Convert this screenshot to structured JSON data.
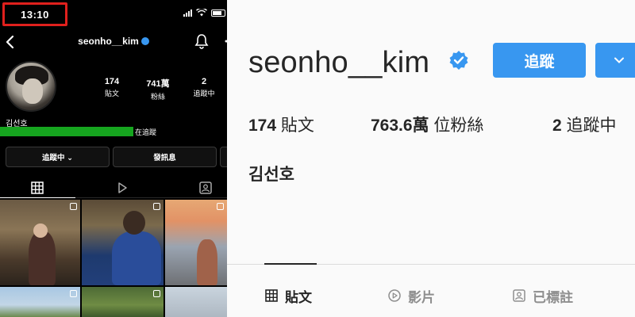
{
  "phone": {
    "time": "13:10",
    "username": "seonho__kim",
    "stats": [
      {
        "value": "174",
        "label": "貼文"
      },
      {
        "value": "741萬",
        "label": "粉絲"
      },
      {
        "value": "2",
        "label": "追蹤中"
      }
    ],
    "full_name": "김선호",
    "following_note": "在追蹤",
    "buttons": {
      "following": "追蹤中 ⌄",
      "message": "發訊息"
    }
  },
  "profile": {
    "username": "seonho__kim",
    "follow_button": "追蹤",
    "stats": {
      "posts_value": "174",
      "posts_label": "貼文",
      "followers_value": "763.6萬",
      "followers_label": "位粉絲",
      "following_value": "2",
      "following_label": "追蹤中"
    },
    "full_name": "김선호",
    "tabs": [
      {
        "label": "貼文",
        "icon": "grid-icon"
      },
      {
        "label": "影片",
        "icon": "reels-icon"
      },
      {
        "label": "已標註",
        "icon": "tagged-icon"
      }
    ]
  },
  "colors": {
    "accent_blue": "#3897f0",
    "highlight_red": "#e0201d",
    "highlight_green": "#16a51f"
  }
}
